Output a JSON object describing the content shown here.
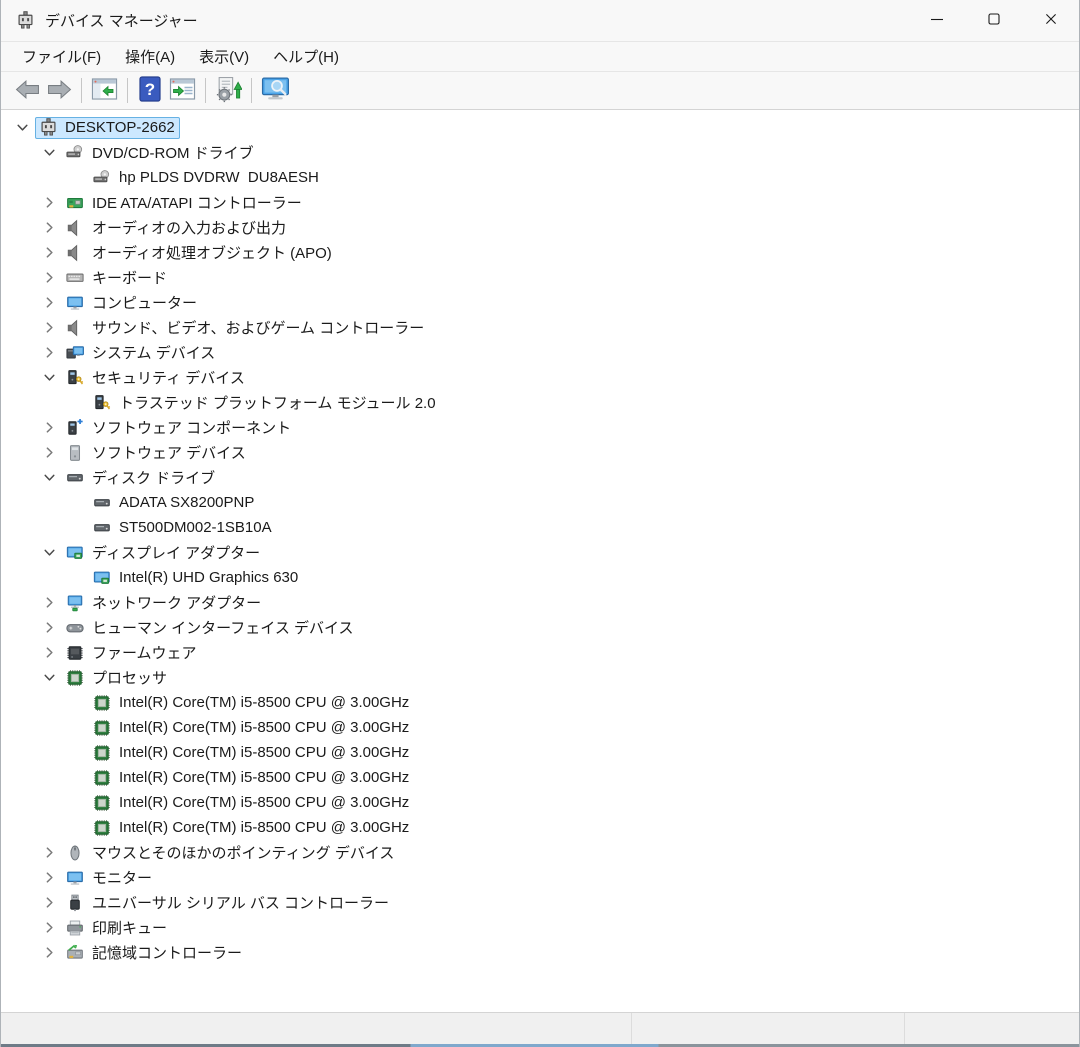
{
  "window": {
    "title": "デバイス マネージャー",
    "controls": [
      {
        "name": "minimize"
      },
      {
        "name": "maximize"
      },
      {
        "name": "close"
      }
    ]
  },
  "menu": {
    "items": [
      {
        "label": "ファイル(F)"
      },
      {
        "label": "操作(A)"
      },
      {
        "label": "表示(V)"
      },
      {
        "label": "ヘルプ(H)"
      }
    ]
  },
  "toolbar": {
    "buttons": [
      {
        "type": "button",
        "name": "back",
        "icon": "arrow-left-icon"
      },
      {
        "type": "button",
        "name": "forward",
        "icon": "arrow-right-icon"
      },
      {
        "type": "separator"
      },
      {
        "type": "button",
        "name": "show-console-tree",
        "icon": "console-tree-icon"
      },
      {
        "type": "separator"
      },
      {
        "type": "button",
        "name": "help",
        "icon": "help-icon"
      },
      {
        "type": "button",
        "name": "properties",
        "icon": "properties-icon"
      },
      {
        "type": "separator"
      },
      {
        "type": "button",
        "name": "scan-hardware-changes",
        "icon": "scan-hardware-icon"
      },
      {
        "type": "separator"
      },
      {
        "type": "button",
        "name": "search-computers",
        "icon": "computer-search-icon"
      }
    ]
  },
  "tree": {
    "items": [
      {
        "label": "DESKTOP-2662",
        "level": 0,
        "expand": "expanded",
        "icon": "computer",
        "selected": true
      },
      {
        "label": "DVD/CD-ROM ドライブ",
        "level": 1,
        "expand": "expanded",
        "icon": "dvd"
      },
      {
        "label": "hp PLDS DVDRW  DU8AESH",
        "level": 2,
        "expand": "none",
        "icon": "dvd"
      },
      {
        "label": "IDE ATA/ATAPI コントローラー",
        "level": 1,
        "expand": "collapsed",
        "icon": "ide"
      },
      {
        "label": "オーディオの入力および出力",
        "level": 1,
        "expand": "collapsed",
        "icon": "audio"
      },
      {
        "label": "オーディオ処理オブジェクト (APO)",
        "level": 1,
        "expand": "collapsed",
        "icon": "audio"
      },
      {
        "label": "キーボード",
        "level": 1,
        "expand": "collapsed",
        "icon": "keyboard"
      },
      {
        "label": "コンピューター",
        "level": 1,
        "expand": "collapsed",
        "icon": "monitor"
      },
      {
        "label": "サウンド、ビデオ、およびゲーム コントローラー",
        "level": 1,
        "expand": "collapsed",
        "icon": "audio"
      },
      {
        "label": "システム デバイス",
        "level": 1,
        "expand": "collapsed",
        "icon": "system"
      },
      {
        "label": "セキュリティ デバイス",
        "level": 1,
        "expand": "expanded",
        "icon": "security"
      },
      {
        "label": "トラステッド プラットフォーム モジュール 2.0",
        "level": 2,
        "expand": "none",
        "icon": "security"
      },
      {
        "label": "ソフトウェア コンポーネント",
        "level": 1,
        "expand": "collapsed",
        "icon": "software-component"
      },
      {
        "label": "ソフトウェア デバイス",
        "level": 1,
        "expand": "collapsed",
        "icon": "software-device"
      },
      {
        "label": "ディスク ドライブ",
        "level": 1,
        "expand": "expanded",
        "icon": "disk"
      },
      {
        "label": "ADATA SX8200PNP",
        "level": 2,
        "expand": "none",
        "icon": "disk"
      },
      {
        "label": "ST500DM002-1SB10A",
        "level": 2,
        "expand": "none",
        "icon": "disk"
      },
      {
        "label": "ディスプレイ アダプター",
        "level": 1,
        "expand": "expanded",
        "icon": "display"
      },
      {
        "label": "Intel(R) UHD Graphics 630",
        "level": 2,
        "expand": "none",
        "icon": "display"
      },
      {
        "label": "ネットワーク アダプター",
        "level": 1,
        "expand": "collapsed",
        "icon": "network"
      },
      {
        "label": "ヒューマン インターフェイス デバイス",
        "level": 1,
        "expand": "collapsed",
        "icon": "hid"
      },
      {
        "label": "ファームウェア",
        "level": 1,
        "expand": "collapsed",
        "icon": "firmware"
      },
      {
        "label": "プロセッサ",
        "level": 1,
        "expand": "expanded",
        "icon": "processor"
      },
      {
        "label": "Intel(R) Core(TM) i5-8500 CPU @ 3.00GHz",
        "level": 2,
        "expand": "none",
        "icon": "processor"
      },
      {
        "label": "Intel(R) Core(TM) i5-8500 CPU @ 3.00GHz",
        "level": 2,
        "expand": "none",
        "icon": "processor"
      },
      {
        "label": "Intel(R) Core(TM) i5-8500 CPU @ 3.00GHz",
        "level": 2,
        "expand": "none",
        "icon": "processor"
      },
      {
        "label": "Intel(R) Core(TM) i5-8500 CPU @ 3.00GHz",
        "level": 2,
        "expand": "none",
        "icon": "processor"
      },
      {
        "label": "Intel(R) Core(TM) i5-8500 CPU @ 3.00GHz",
        "level": 2,
        "expand": "none",
        "icon": "processor"
      },
      {
        "label": "Intel(R) Core(TM) i5-8500 CPU @ 3.00GHz",
        "level": 2,
        "expand": "none",
        "icon": "processor"
      },
      {
        "label": "マウスとそのほかのポインティング デバイス",
        "level": 1,
        "expand": "collapsed",
        "icon": "mouse"
      },
      {
        "label": "モニター",
        "level": 1,
        "expand": "collapsed",
        "icon": "monitor"
      },
      {
        "label": "ユニバーサル シリアル バス コントローラー",
        "level": 1,
        "expand": "collapsed",
        "icon": "usb"
      },
      {
        "label": "印刷キュー",
        "level": 1,
        "expand": "collapsed",
        "icon": "printer"
      },
      {
        "label": "記憶域コントローラー",
        "level": 1,
        "expand": "collapsed",
        "icon": "storage"
      }
    ]
  },
  "status_bar": {
    "sections": [
      "",
      "",
      ""
    ]
  },
  "colors": {
    "selection_bg": "#cce8ff",
    "selection_border": "#66b1e3",
    "chrome_bg": "#f8f8f8",
    "tree_bg": "#ffffff",
    "status_bg": "#f0f0f0"
  }
}
